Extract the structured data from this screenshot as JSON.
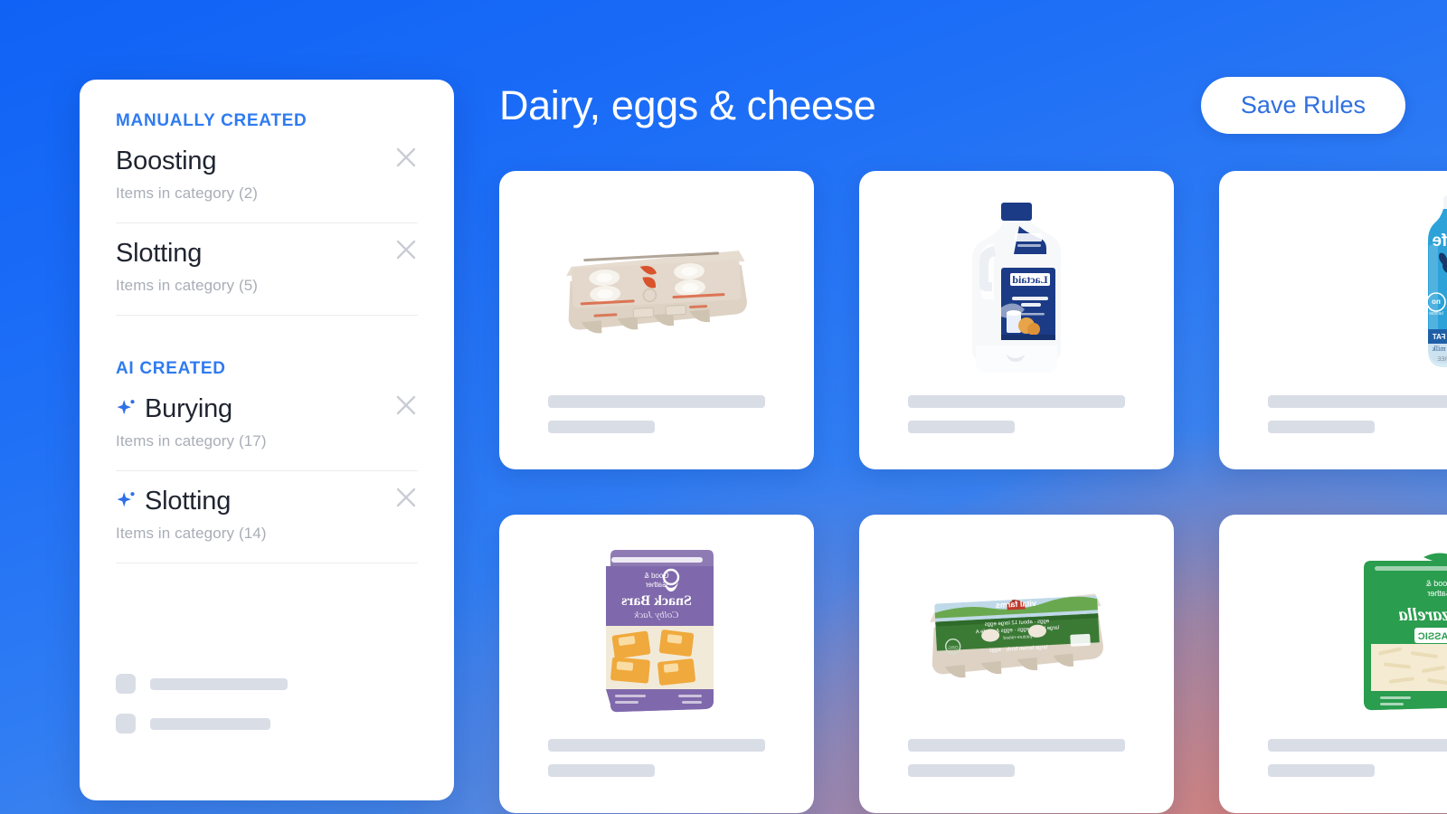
{
  "theme": {
    "accent_blue": "#2f7bf0",
    "bg_blue": "#1a6dff",
    "bg_accent_warm": "#e28070",
    "card_white": "#ffffff",
    "skeleton_gray": "#d9dde6",
    "muted_text": "#a9adb6"
  },
  "sidebar": {
    "sections": [
      {
        "label": "MANUALLY CREATED",
        "ai": false,
        "items": [
          {
            "name": "Boosting",
            "subtitle": "Items in category (2)",
            "count": 2,
            "remove_icon": "close-icon"
          },
          {
            "name": "Slotting",
            "subtitle": "Items in category (5)",
            "count": 5,
            "remove_icon": "close-icon"
          }
        ]
      },
      {
        "label": "AI CREATED",
        "ai": true,
        "items": [
          {
            "name": "Burying",
            "subtitle": "Items in category (17)",
            "count": 17,
            "icon": "sparkle-icon",
            "remove_icon": "close-icon"
          },
          {
            "name": "Slotting",
            "subtitle": "Items in category (14)",
            "count": 14,
            "icon": "sparkle-icon",
            "remove_icon": "close-icon"
          }
        ]
      }
    ],
    "skeleton_rows": 2
  },
  "header": {
    "title": "Dairy, eggs & cheese",
    "save_label": "Save Rules"
  },
  "products": [
    {
      "id": "p1",
      "art": "egg-carton-tan",
      "alt": "Tan paperboard egg carton"
    },
    {
      "id": "p2",
      "art": "milk-jug",
      "alt": "Lactaid 2% reduced fat milk jug"
    },
    {
      "id": "p3",
      "art": "fairlife-bottle",
      "alt": "fairlife reduced fat ultra filtered milk bottle"
    },
    {
      "id": "p4",
      "art": "cheese-pouch",
      "alt": "Good & Gather Snack Bars Colby Jack pouch"
    },
    {
      "id": "p5",
      "art": "egg-carton-green",
      "alt": "Green pasture raised egg carton"
    },
    {
      "id": "p6",
      "art": "mozzarella-bag",
      "alt": "Mozzarella Classic shredded cheese bag"
    }
  ]
}
